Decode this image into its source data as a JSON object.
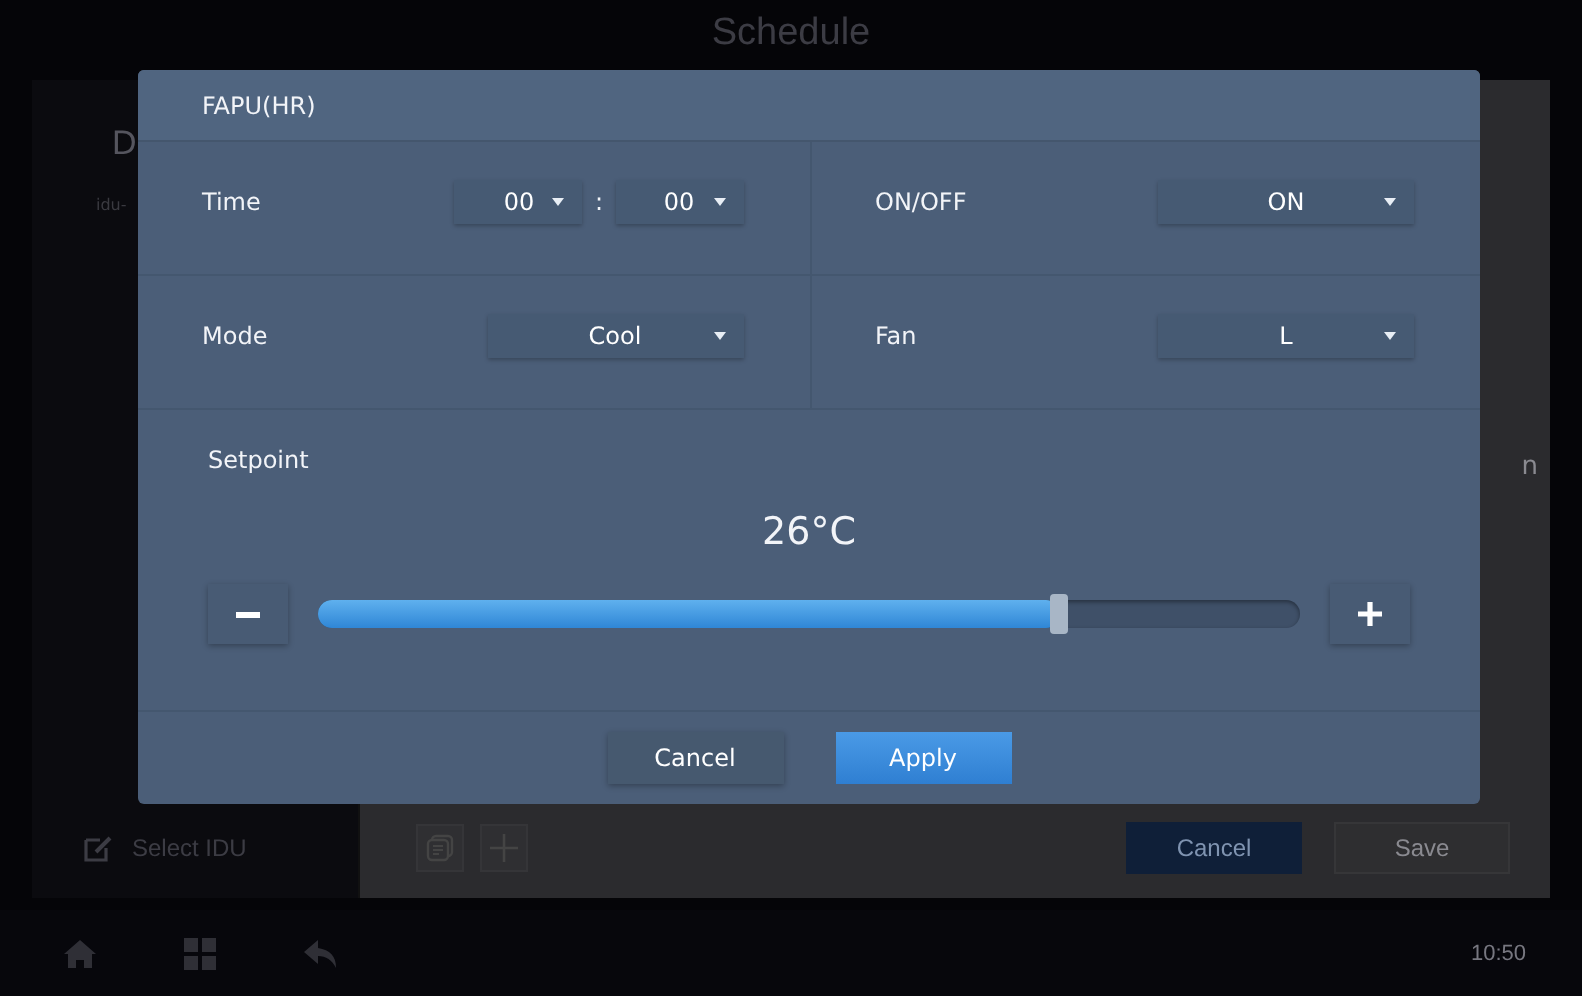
{
  "background": {
    "title": "Schedule",
    "sidebar_text": "D",
    "list_item": "idu-",
    "right_text": "n",
    "select_button": "Select IDU",
    "cancel_button": "Cancel",
    "save_button": "Save"
  },
  "taskbar": {
    "time": "10:50"
  },
  "dialog": {
    "title": "FAPU(HR)",
    "rows": [
      {
        "cells": [
          {
            "label": "Time",
            "separator": ":",
            "dropdowns": [
              "00",
              "00"
            ]
          },
          {
            "label": "ON/OFF",
            "dropdowns": [
              "ON"
            ]
          }
        ]
      },
      {
        "cells": [
          {
            "label": "Mode",
            "dropdowns": [
              "Cool"
            ]
          },
          {
            "label": "Fan",
            "dropdowns": [
              "L"
            ]
          }
        ]
      }
    ],
    "setpoint": {
      "label": "Setpoint",
      "value": "26°C",
      "level": 0.755
    },
    "buttons": [
      {
        "label": "Cancel",
        "kind": "secondary"
      },
      {
        "label": "Apply",
        "kind": "primary"
      }
    ]
  }
}
